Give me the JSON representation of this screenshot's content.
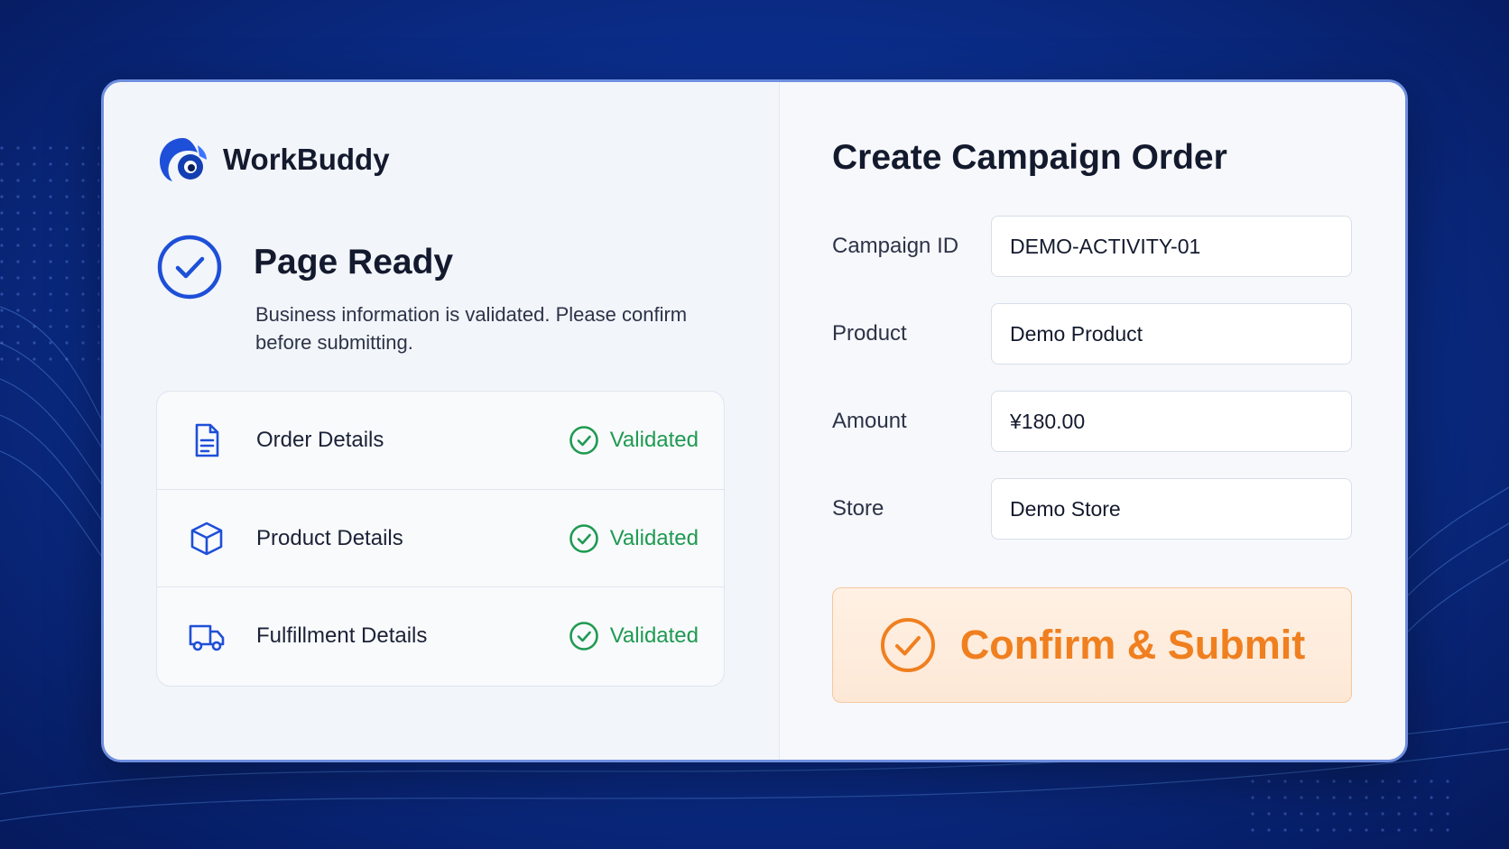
{
  "brand": {
    "name": "WorkBuddy",
    "accent": "#1e4fd8"
  },
  "status": {
    "title": "Page Ready",
    "description": "Business information is validated. Please confirm before submitting.",
    "accent": "#1e4fd8"
  },
  "checklist": [
    {
      "label": "Order Details",
      "status": "Validated",
      "icon": "document-icon"
    },
    {
      "label": "Product Details",
      "status": "Validated",
      "icon": "box-icon"
    },
    {
      "label": "Fulfillment Details",
      "status": "Validated",
      "icon": "truck-icon"
    }
  ],
  "form": {
    "title": "Create Campaign Order",
    "fields": [
      {
        "label": "Campaign ID",
        "value": "DEMO-ACTIVITY-01"
      },
      {
        "label": "Product",
        "value": "Demo Product"
      },
      {
        "label": "Amount",
        "value": "¥180.00"
      },
      {
        "label": "Store",
        "value": "Demo Store"
      }
    ],
    "submit_label": "Confirm & Submit",
    "submit_color": "#f07f1f"
  },
  "colors": {
    "validated": "#1f9a52",
    "background": "#0b2f8f"
  }
}
